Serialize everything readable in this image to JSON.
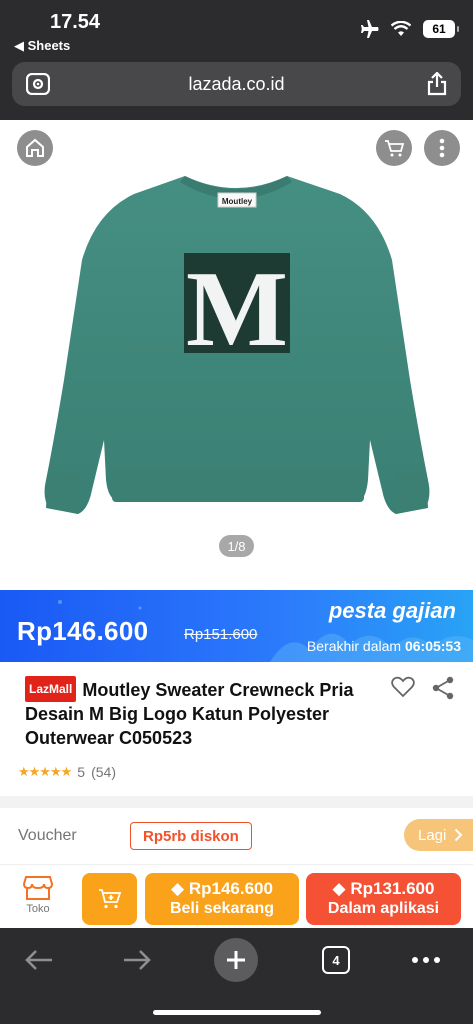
{
  "status_bar": {
    "time": "17.54",
    "back_app": "Sheets",
    "battery": "61"
  },
  "browser": {
    "url": "lazada.co.id"
  },
  "product_image": {
    "counter": "1/8",
    "logo_letter": "M",
    "tag_text": "Moutley"
  },
  "banner": {
    "price": "Rp146.600",
    "old_price": "Rp151.600",
    "brand": "pesta gajian",
    "countdown_label": "Berakhir dalam",
    "countdown_time": "06:05:53"
  },
  "product": {
    "badge": "LazMall",
    "title": "Moutley Sweater Crewneck Pria Desain M Big Logo Katun Polyester Outerwear C050523",
    "rating_stars": 5,
    "rating_value": "5",
    "rating_count": "(54)"
  },
  "voucher": {
    "label": "Voucher",
    "chip": "Rp5rb diskon",
    "more": "Lagi"
  },
  "actions": {
    "store_label": "Toko",
    "buy_price": "Rp146.600",
    "buy_label": "Beli sekarang",
    "app_price": "Rp131.600",
    "app_label": "Dalam aplikasi"
  },
  "toolbar": {
    "tab_count": "4"
  },
  "colors": {
    "banner_blue": "#1a59f5",
    "lazada_orange": "#f9a21a",
    "app_red": "#f55235",
    "lazmall_red": "#e2231a",
    "sweater_green": "#3f8a7c"
  },
  "icons": [
    "home-icon",
    "cart-icon",
    "more-icon",
    "heart-icon",
    "share-icon",
    "store-icon",
    "add-to-cart-icon",
    "back-arrow-icon",
    "forward-arrow-icon",
    "new-tab-icon",
    "tabs-icon",
    "menu-dots-icon"
  ]
}
